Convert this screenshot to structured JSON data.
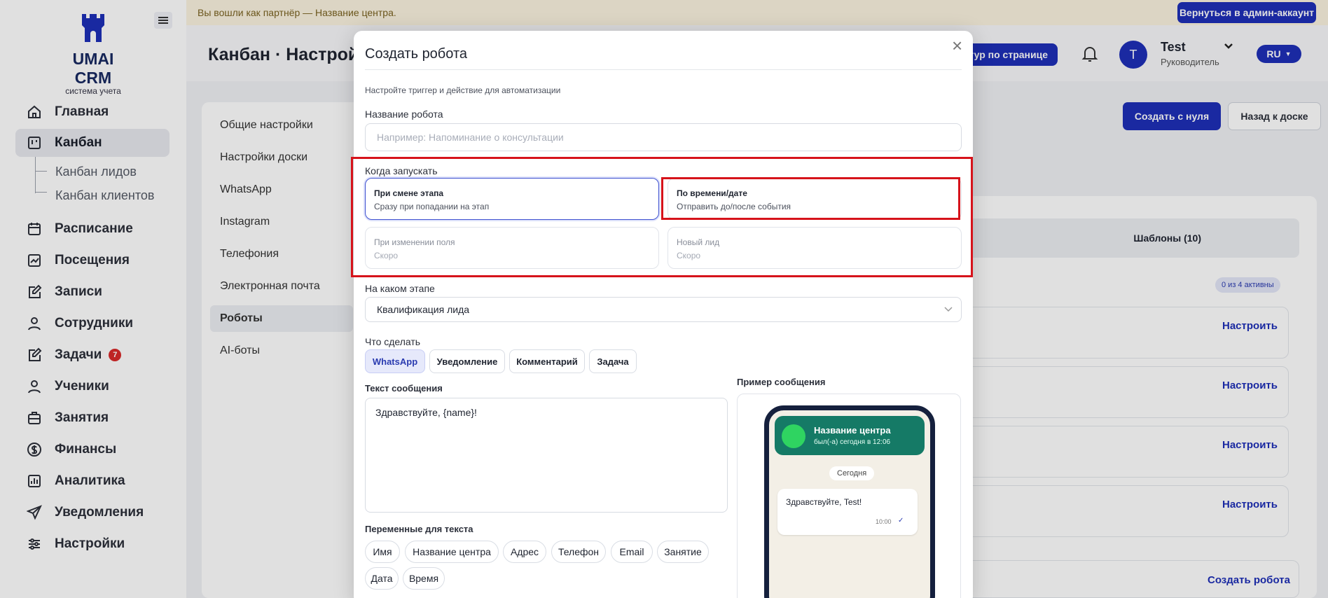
{
  "brand": {
    "title": "UMAI CRM",
    "subtitle": "система учета"
  },
  "banner": {
    "text": "Вы вошли как партнёр — Название центра.",
    "return_button": "Вернуться в админ-аккаунт"
  },
  "header": {
    "page_title": "Канбан · Настрой",
    "tour_button": "тур по странице",
    "user_name": "Test",
    "user_role": "Руководитель",
    "avatar_letter": "T",
    "lang": "RU"
  },
  "nav": {
    "main": "Главная",
    "kanban": "Канбан",
    "kanban_leads": "Канбан лидов",
    "kanban_clients": "Канбан клиентов",
    "schedule": "Расписание",
    "visits": "Посещения",
    "records": "Записи",
    "staff": "Сотрудники",
    "tasks": "Задачи",
    "tasks_count": "7",
    "students": "Ученики",
    "lessons": "Занятия",
    "finance": "Финансы",
    "analytics": "Аналитика",
    "notifications": "Уведомления",
    "settings": "Настройки"
  },
  "settings_menu": [
    "Общие настройки",
    "Настройки доски",
    "WhatsApp",
    "Instagram",
    "Телефония",
    "Электронная почта",
    "Роботы",
    "AI-боты"
  ],
  "page_actions": {
    "create_scratch": "Создать с нуля",
    "back_to_board": "Назад к доске"
  },
  "right_panel": {
    "templates_tab": "Шаблоны (10)",
    "active_badge": "0 из 4 активны",
    "configure": "Настроить",
    "create_robot": "Создать робота"
  },
  "modal": {
    "title": "Создать робота",
    "close": "×",
    "hint": "Настройте триггер и действие для автоматизации",
    "name_label": "Название робота",
    "name_placeholder": "Например: Напоминание о консультации",
    "when_label": "Когда запускать",
    "triggers": [
      {
        "title": "При смене этапа",
        "sub": "Сразу при попадании на этап"
      },
      {
        "title": "По времени/дате",
        "sub": "Отправить до/после события"
      },
      {
        "title": "При изменении поля",
        "sub": "Скоро"
      },
      {
        "title": "Новый лид",
        "sub": "Скоро"
      }
    ],
    "stage_label": "На каком этапе",
    "stage_value": "Квалификация лида",
    "action_label": "Что сделать",
    "actions": [
      "WhatsApp",
      "Уведомление",
      "Комментарий",
      "Задача"
    ],
    "message_label": "Текст сообщения",
    "message_value": "Здравствуйте, {name}!",
    "vars_label": "Переменные для текста",
    "variables": [
      "Имя",
      "Название центра",
      "Адрес",
      "Телефон",
      "Email",
      "Занятие",
      "Дата",
      "Время"
    ],
    "preview_label": "Пример сообщения",
    "preview": {
      "chat_name": "Название центра",
      "chat_status": "был(-а) сегодня в 12:06",
      "date_chip": "Сегодня",
      "bubble_text": "Здравствуйте, Test!",
      "bubble_time": "10:00"
    }
  },
  "colors": {
    "accent": "#1e2fb8",
    "highlight": "#d6131b",
    "whatsapp_header": "#157a66"
  }
}
